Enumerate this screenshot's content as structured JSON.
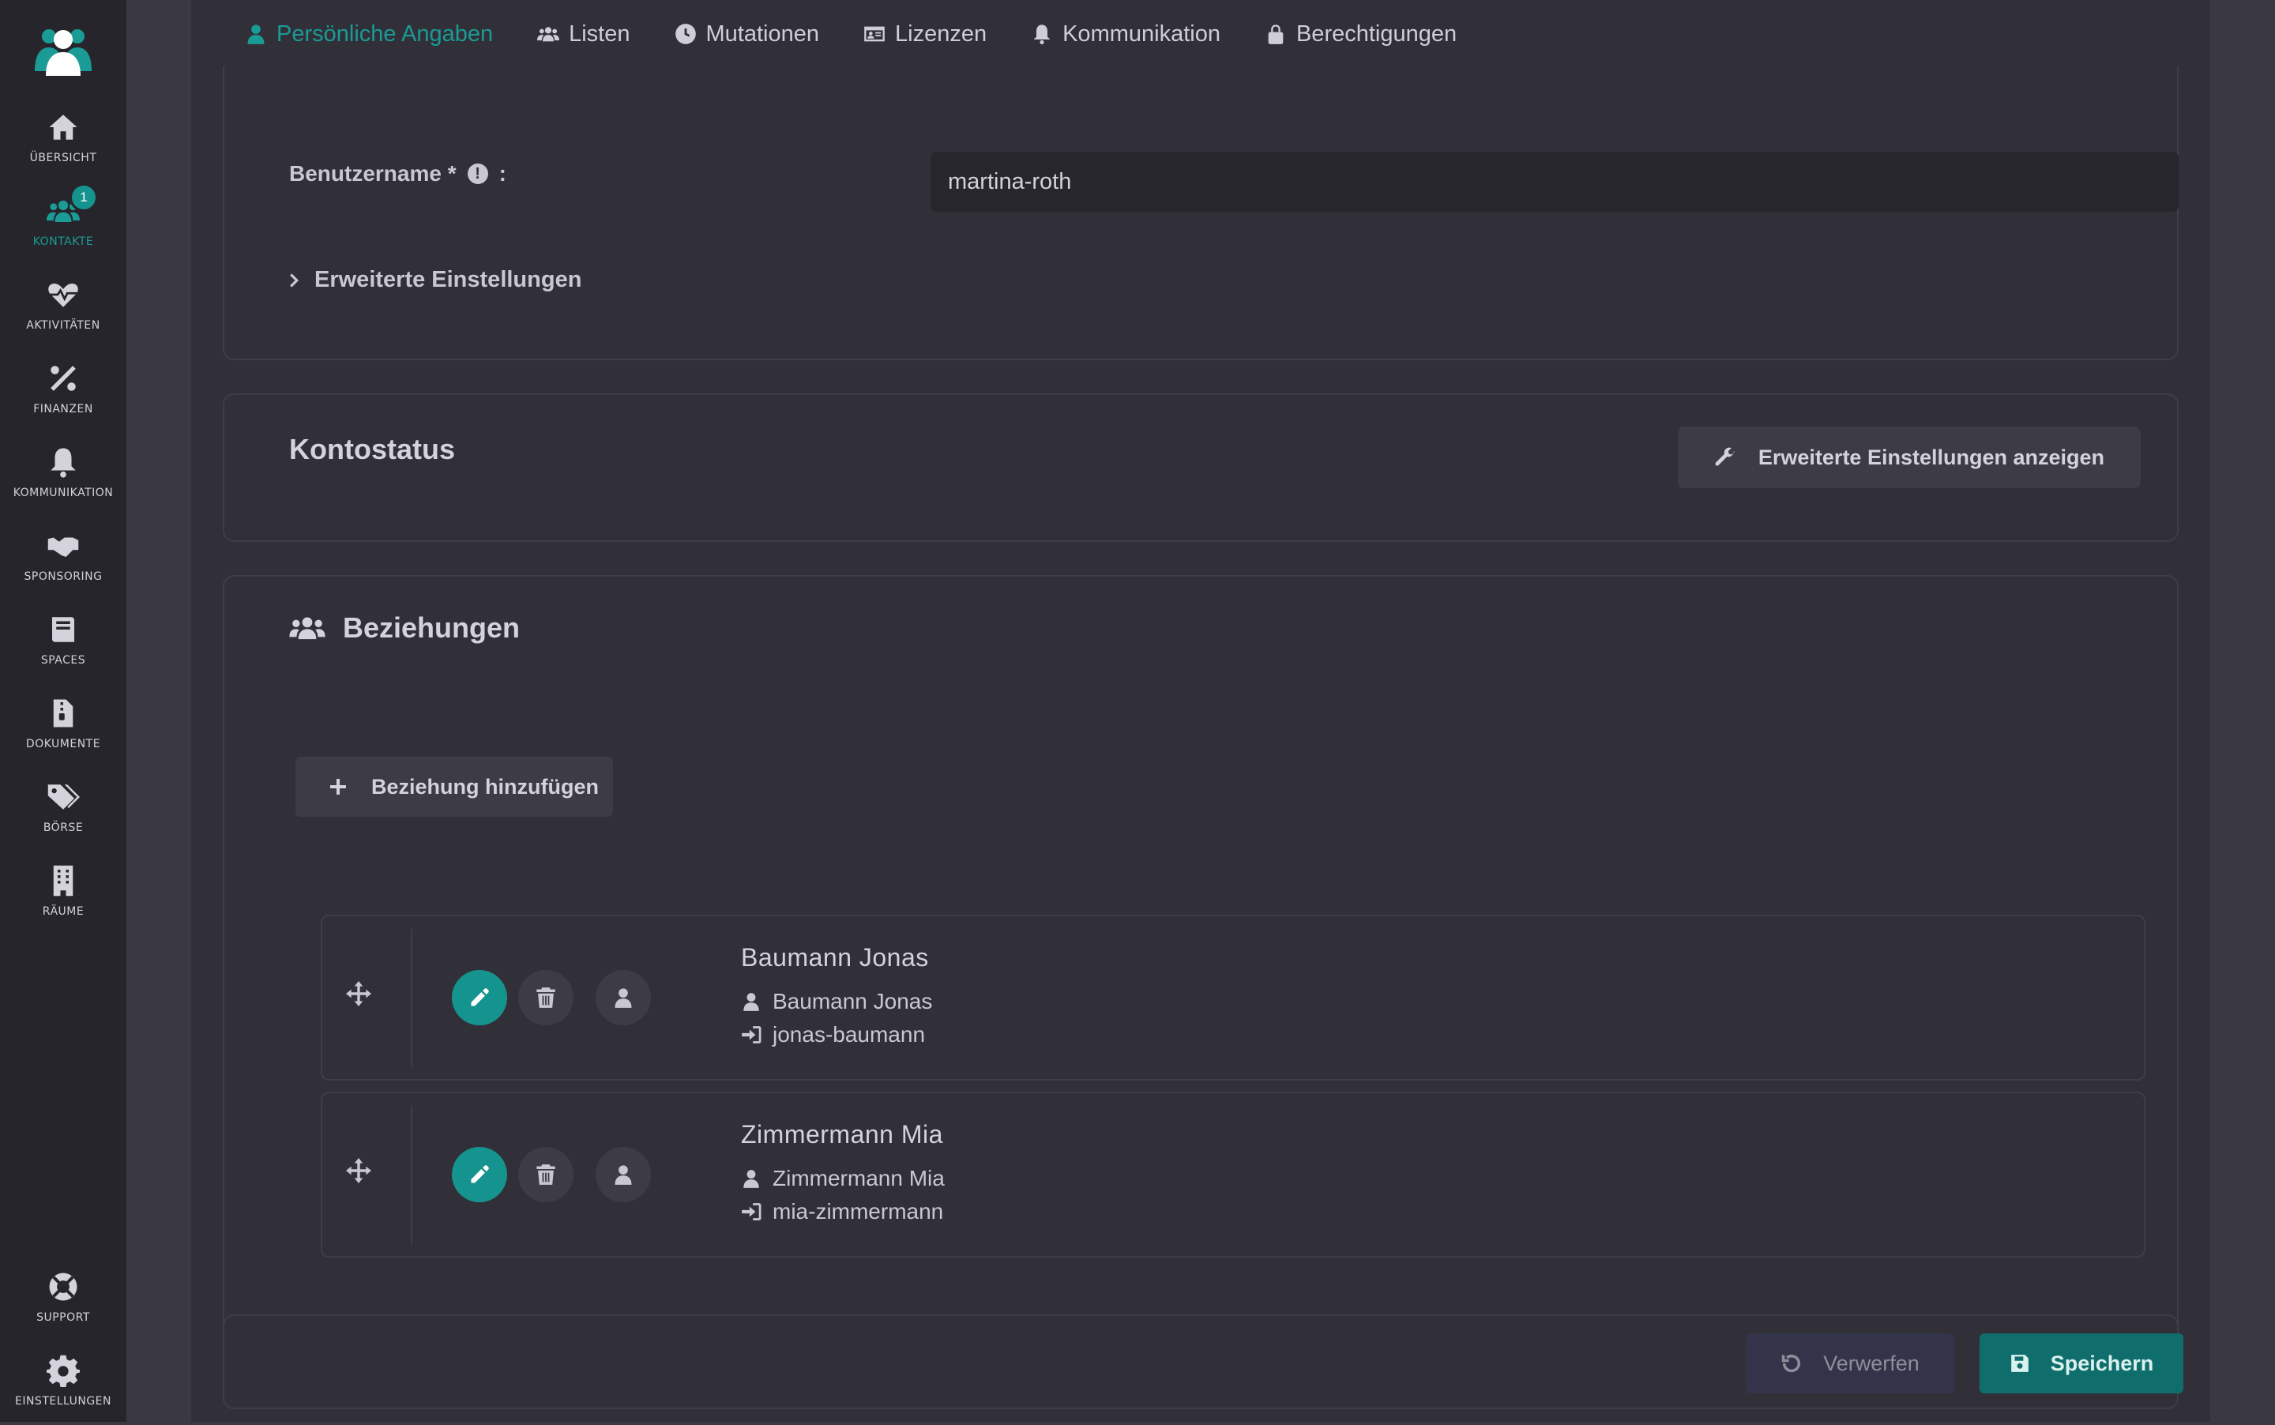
{
  "sidebar": {
    "items": [
      {
        "label": "ÜBERSICHT",
        "icon": "home-icon"
      },
      {
        "label": "KONTAKTE",
        "icon": "users-icon",
        "badge": "1",
        "active": true
      },
      {
        "label": "AKTIVITÄTEN",
        "icon": "heartbeat-icon"
      },
      {
        "label": "FINANZEN",
        "icon": "percent-icon"
      },
      {
        "label": "KOMMUNIKATION",
        "icon": "bell-icon"
      },
      {
        "label": "SPONSORING",
        "icon": "handshake-icon"
      },
      {
        "label": "SPACES",
        "icon": "book-icon"
      },
      {
        "label": "DOKUMENTE",
        "icon": "file-zip-icon"
      },
      {
        "label": "BÖRSE",
        "icon": "tags-icon"
      },
      {
        "label": "RÄUME",
        "icon": "building-icon"
      }
    ],
    "bottom": [
      {
        "label": "SUPPORT",
        "icon": "life-ring-icon"
      },
      {
        "label": "EINSTELLUNGEN",
        "icon": "gear-icon"
      }
    ]
  },
  "tabs": [
    {
      "label": "Persönliche Angaben",
      "icon": "user-icon",
      "active": true
    },
    {
      "label": "Listen",
      "icon": "users-icon"
    },
    {
      "label": "Mutationen",
      "icon": "clock-icon"
    },
    {
      "label": "Lizenzen",
      "icon": "id-card-icon"
    },
    {
      "label": "Kommunikation",
      "icon": "bell-icon"
    },
    {
      "label": "Berechtigungen",
      "icon": "lock-icon"
    }
  ],
  "username": {
    "label": "Benutzername *",
    "label_suffix": ":",
    "info": "!",
    "value": "martina-roth"
  },
  "advanced": {
    "label": "Erweiterte Einstellungen"
  },
  "account": {
    "title": "Kontostatus",
    "button": "Erweiterte Einstellungen anzeigen"
  },
  "relations": {
    "title": "Beziehungen",
    "add_button": "Beziehung hinzufügen",
    "rows": [
      {
        "name": "Baumann Jonas",
        "person": "Baumann Jonas",
        "login": "jonas-baumann"
      },
      {
        "name": "Zimmermann Mia",
        "person": "Zimmermann Mia",
        "login": "mia-zimmermann"
      }
    ]
  },
  "footer": {
    "discard": "Verwerfen",
    "save": "Speichern"
  },
  "colors": {
    "accent": "#1a9b95",
    "sidebar_bg": "#26252b",
    "panel_bg": "#313038"
  }
}
